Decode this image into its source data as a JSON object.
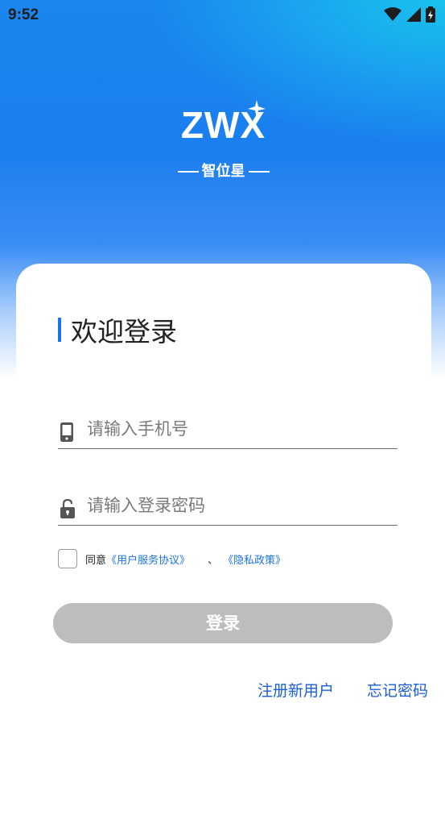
{
  "status_bar": {
    "time": "9:52"
  },
  "logo": {
    "text": "ZWX",
    "subtitle": "智位星"
  },
  "welcome": {
    "title": "欢迎登录"
  },
  "phone_field": {
    "placeholder": "请输入手机号"
  },
  "password_field": {
    "placeholder": "请输入登录密码"
  },
  "agreement": {
    "prefix": "同意",
    "user_agreement": "《用户服务协议》",
    "separator": "、",
    "privacy_policy": "《隐私政策》",
    "checked": false
  },
  "login_button": {
    "label": "登录"
  },
  "links": {
    "register": "注册新用户",
    "forgot_password": "忘记密码"
  },
  "colors": {
    "accent": "#1a73e8",
    "button_disabled": "#bdbdbd",
    "hero_top": "#1a86ee"
  },
  "icons": {
    "phone": "mobile-phone-icon",
    "lock": "lock-icon",
    "wifi": "wifi-icon",
    "signal": "signal-icon",
    "battery": "battery-icon"
  }
}
